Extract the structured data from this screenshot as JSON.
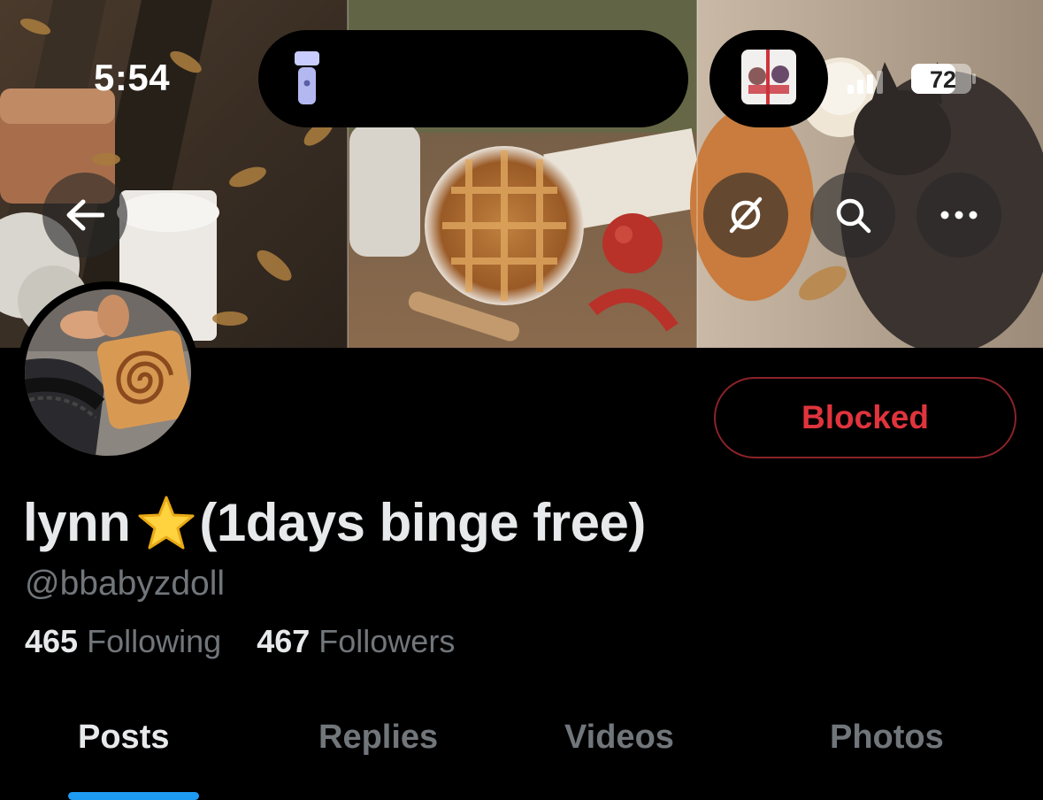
{
  "status_bar": {
    "time": "5:54",
    "battery": "72"
  },
  "profile": {
    "name": "lynn",
    "name_suffix": "(1days binge free)",
    "name_emoji": "star-icon",
    "handle": "@bbabyzdoll",
    "following_count": "465",
    "following_label": "Following",
    "followers_count": "467",
    "followers_label": "Followers"
  },
  "actions": {
    "back_icon": "back-arrow-icon",
    "grok_icon": "grok-icon",
    "search_icon": "search-icon",
    "more_icon": "more-icon",
    "blocked_label": "Blocked"
  },
  "tabs": [
    {
      "label": "Posts",
      "active": true
    },
    {
      "label": "Replies",
      "active": false
    },
    {
      "label": "Videos",
      "active": false
    },
    {
      "label": "Photos",
      "active": false
    }
  ],
  "colors": {
    "accent": "#1d9bf0",
    "blocked_red": "#e0343d",
    "muted_text": "#71767b",
    "background": "#000000"
  }
}
